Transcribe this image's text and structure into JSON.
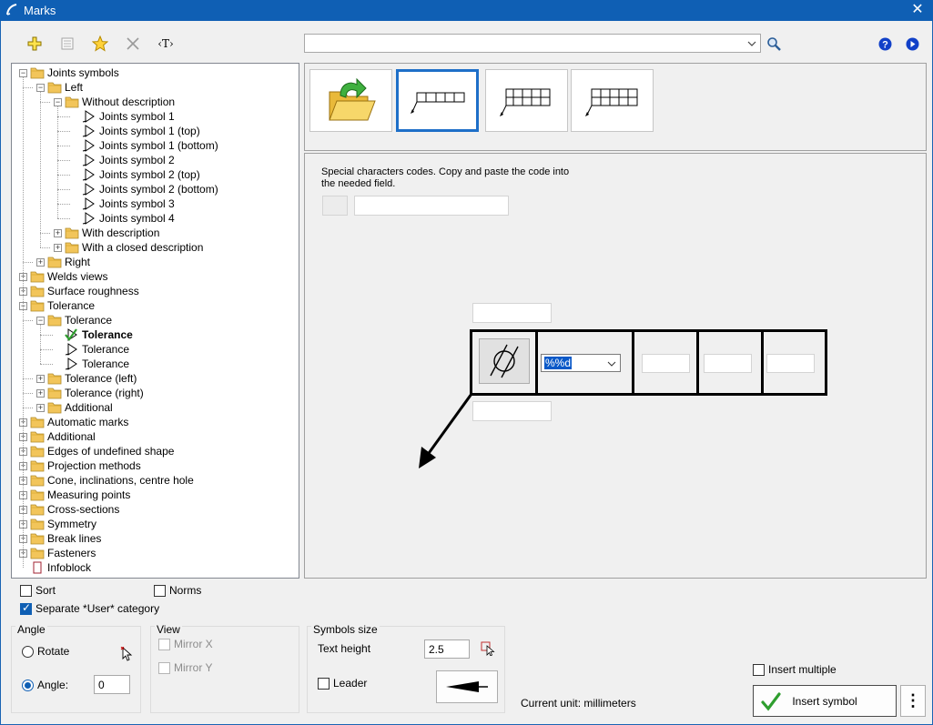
{
  "window": {
    "title": "Marks",
    "close_glyph": "✕"
  },
  "toolbar": {
    "icons": [
      "add-icon",
      "properties-icon",
      "favorite-star-icon",
      "delete-cross-icon",
      "text-insert-icon"
    ],
    "text_tool_label": "‹T›",
    "search_value": "",
    "help_glyph": "?",
    "next_glyph": "▶"
  },
  "tree": {
    "items": [
      {
        "label": "Joints symbols",
        "level": 0,
        "type": "folder",
        "state": "expanded"
      },
      {
        "label": "Left",
        "level": 1,
        "type": "folder",
        "state": "expanded"
      },
      {
        "label": "Without description",
        "level": 2,
        "type": "folder",
        "state": "expanded"
      },
      {
        "label": "Joints symbol 1",
        "level": 3,
        "type": "symbol"
      },
      {
        "label": "Joints symbol 1 (top)",
        "level": 3,
        "type": "symbol"
      },
      {
        "label": "Joints symbol 1 (bottom)",
        "level": 3,
        "type": "symbol"
      },
      {
        "label": "Joints symbol 2",
        "level": 3,
        "type": "symbol"
      },
      {
        "label": "Joints symbol 2 (top)",
        "level": 3,
        "type": "symbol"
      },
      {
        "label": "Joints symbol 2 (bottom)",
        "level": 3,
        "type": "symbol"
      },
      {
        "label": "Joints symbol 3",
        "level": 3,
        "type": "symbol"
      },
      {
        "label": "Joints symbol 4",
        "level": 3,
        "type": "symbol"
      },
      {
        "label": "With description",
        "level": 2,
        "type": "folder",
        "state": "collapsed"
      },
      {
        "label": "With a closed description",
        "level": 2,
        "type": "folder",
        "state": "collapsed"
      },
      {
        "label": "Right",
        "level": 1,
        "type": "folder",
        "state": "collapsed"
      },
      {
        "label": "Welds views",
        "level": 0,
        "type": "folder",
        "state": "collapsed"
      },
      {
        "label": "Surface roughness",
        "level": 0,
        "type": "folder",
        "state": "collapsed"
      },
      {
        "label": "Tolerance",
        "level": 0,
        "type": "folder",
        "state": "expanded"
      },
      {
        "label": "Tolerance",
        "level": 1,
        "type": "folder",
        "state": "expanded"
      },
      {
        "label": "Tolerance",
        "level": 2,
        "type": "symbol-checked",
        "selected": true
      },
      {
        "label": "Tolerance",
        "level": 2,
        "type": "symbol"
      },
      {
        "label": "Tolerance",
        "level": 2,
        "type": "symbol"
      },
      {
        "label": "Tolerance (left)",
        "level": 1,
        "type": "folder",
        "state": "collapsed"
      },
      {
        "label": "Tolerance (right)",
        "level": 1,
        "type": "folder",
        "state": "collapsed"
      },
      {
        "label": "Additional",
        "level": 1,
        "type": "folder",
        "state": "collapsed"
      },
      {
        "label": "Automatic marks",
        "level": 0,
        "type": "folder",
        "state": "collapsed"
      },
      {
        "label": "Additional",
        "level": 0,
        "type": "folder",
        "state": "collapsed"
      },
      {
        "label": "Edges of undefined shape",
        "level": 0,
        "type": "folder",
        "state": "collapsed"
      },
      {
        "label": "Projection methods",
        "level": 0,
        "type": "folder",
        "state": "collapsed"
      },
      {
        "label": "Cone, inclinations, centre hole",
        "level": 0,
        "type": "folder",
        "state": "collapsed"
      },
      {
        "label": "Measuring points",
        "level": 0,
        "type": "folder",
        "state": "collapsed"
      },
      {
        "label": "Cross-sections",
        "level": 0,
        "type": "folder",
        "state": "collapsed"
      },
      {
        "label": "Symmetry",
        "level": 0,
        "type": "folder",
        "state": "collapsed"
      },
      {
        "label": "Break lines",
        "level": 0,
        "type": "folder",
        "state": "collapsed"
      },
      {
        "label": "Fasteners",
        "level": 0,
        "type": "folder",
        "state": "collapsed"
      },
      {
        "label": "Infoblock",
        "level": 0,
        "type": "page"
      }
    ]
  },
  "thumbnails": [
    "open-folder-icon",
    "tolerance-frame-1",
    "tolerance-frame-2",
    "tolerance-frame-3"
  ],
  "editor": {
    "special_codes_text": "Special characters codes. Copy and paste the code into the needed field.",
    "tolerance_value": "%%d",
    "top_field": "",
    "bottom_field": ""
  },
  "options": {
    "sort_label": "Sort",
    "norms_label": "Norms",
    "separate_user_label": "Separate *User* category",
    "sort_checked": false,
    "norms_checked": false,
    "separate_user_checked": true
  },
  "angle": {
    "group_title": "Angle",
    "rotate_label": "Rotate",
    "angle_label": "Angle:",
    "angle_value": "0"
  },
  "view": {
    "group_title": "View",
    "mirror_x_label": "Mirror X",
    "mirror_y_label": "Mirror Y"
  },
  "symbols_size": {
    "group_title": "Symbols size",
    "text_height_label": "Text height",
    "text_height_value": "2.5",
    "leader_label": "Leader"
  },
  "footer": {
    "current_unit": "Current unit: millimeters",
    "insert_multiple_label": "Insert multiple",
    "insert_symbol_label": "Insert symbol",
    "more_glyph": "⋮"
  },
  "colors": {
    "title_bar": "#0f5fb4",
    "accent": "#1e6fc8",
    "folder": "#f2c55a",
    "check": "#2e9e2e"
  }
}
